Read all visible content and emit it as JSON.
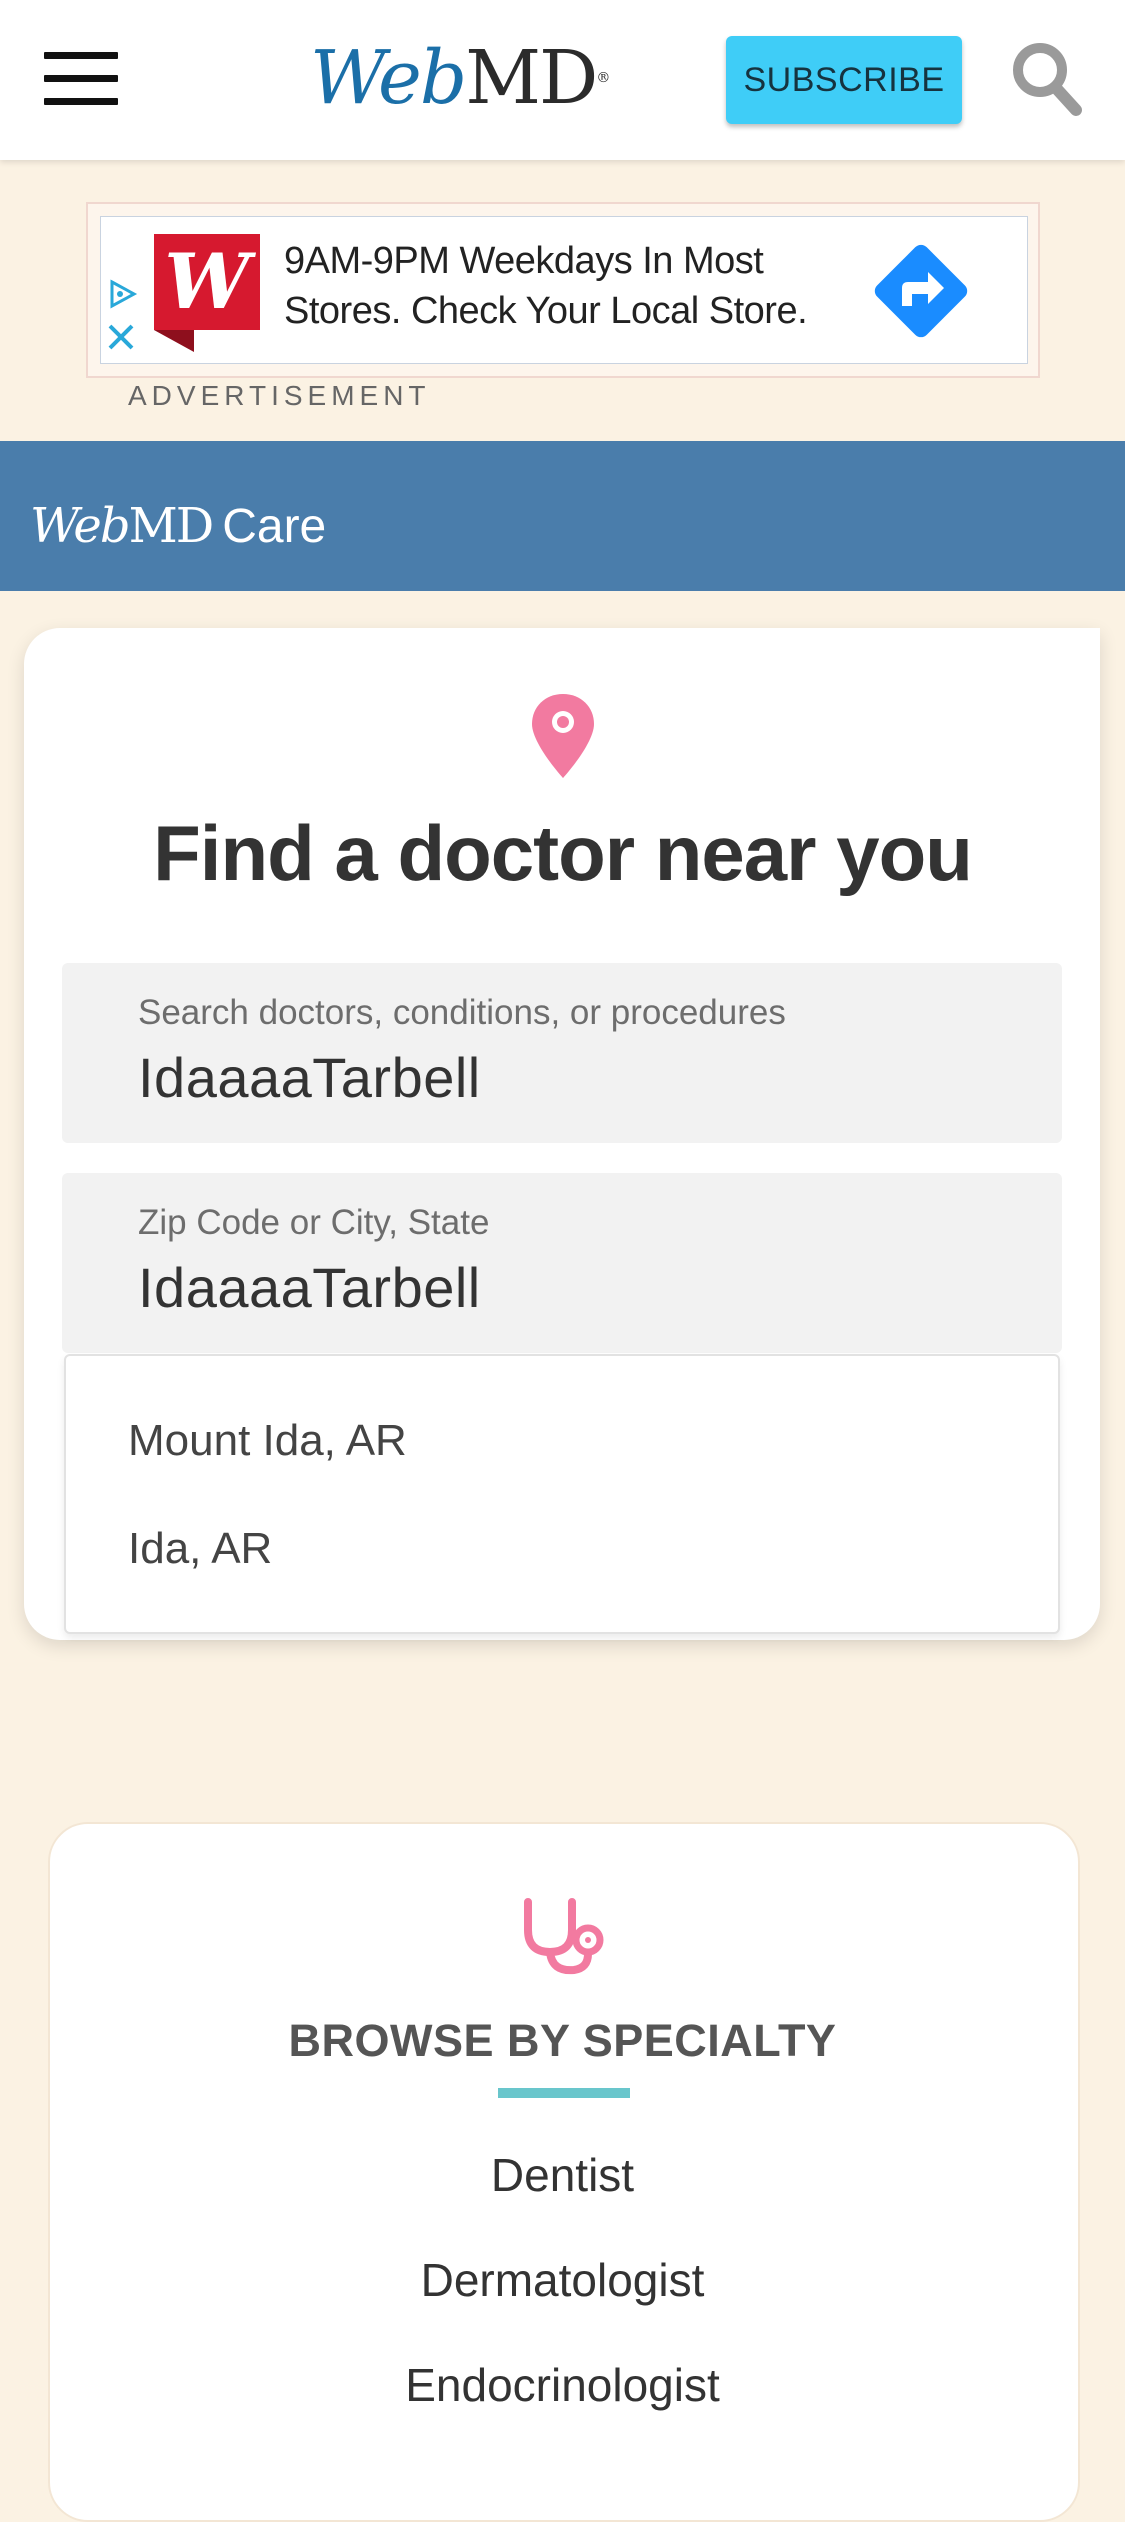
{
  "header": {
    "logo_web": "Web",
    "logo_md": "MD",
    "logo_reg": "®",
    "subscribe_label": "SUBSCRIBE",
    "menu_icon": "hamburger-menu-icon",
    "search_icon": "search-icon"
  },
  "ad": {
    "text": "9AM-9PM Weekdays In Most Stores. Check Your Local Store.",
    "label": "ADVERTISEMENT",
    "brand_logo_letter": "W",
    "brand_color": "#d6192f",
    "arrow_color": "#1a8cff"
  },
  "care": {
    "logo_web": "Web",
    "logo_md": "MD",
    "logo_care": "Care",
    "band_color": "#4a7dab"
  },
  "find": {
    "title": "Find a doctor near you",
    "search_field": {
      "label": "Search doctors, conditions, or procedures",
      "value": "IdaaaaTarbell"
    },
    "location_field": {
      "label": "Zip Code or City, State",
      "value": "IdaaaaTarbell"
    },
    "suggestions": [
      "Mount Ida, AR",
      "Ida, AR"
    ],
    "accent_color": "#f27aa0"
  },
  "browse": {
    "title": "BROWSE BY SPECIALTY",
    "underline_color": "#69c6cc",
    "specialties": [
      "Dentist",
      "Dermatologist",
      "Endocrinologist"
    ]
  }
}
